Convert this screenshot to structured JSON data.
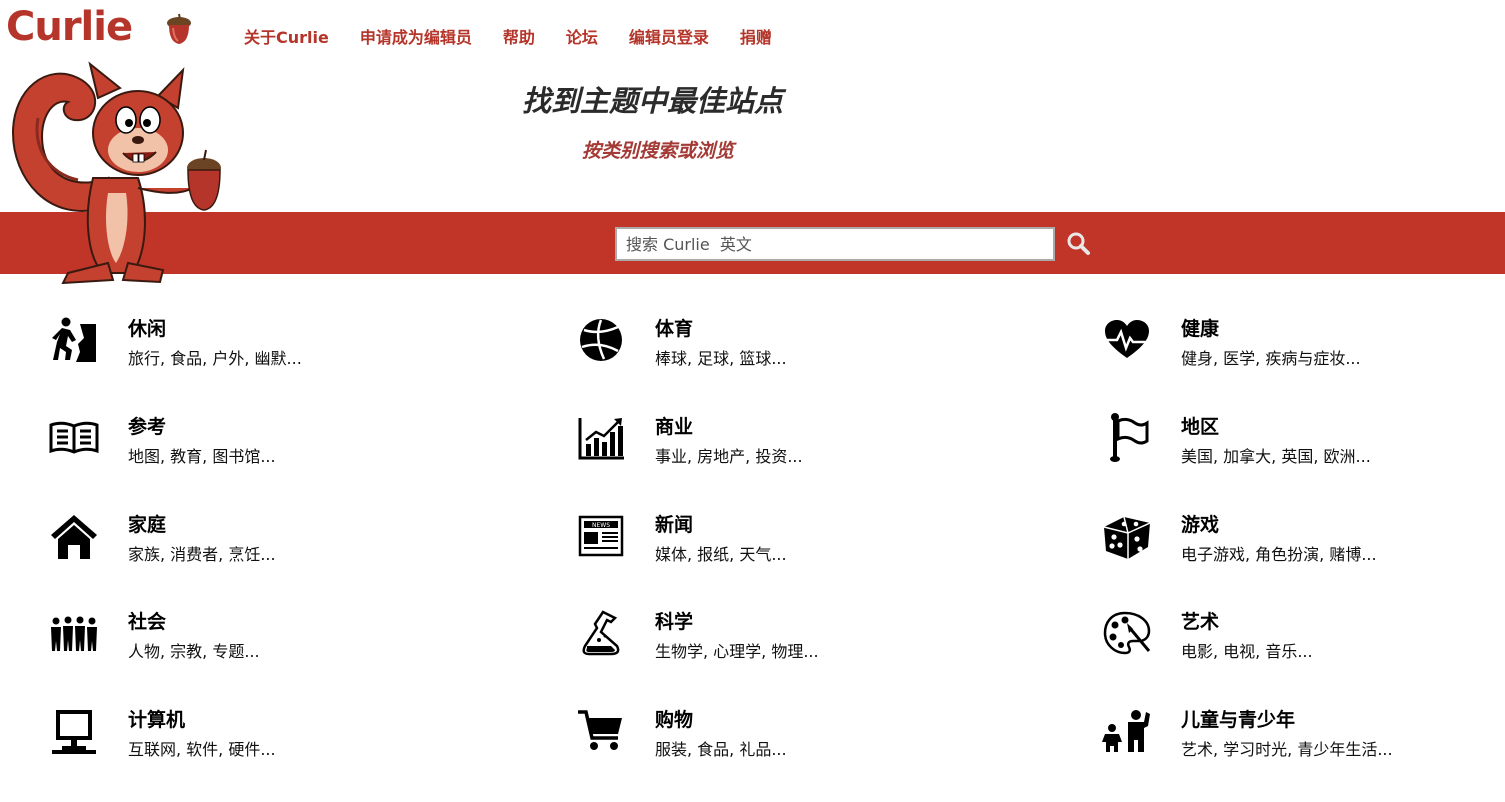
{
  "logo": {
    "text": "Curlie"
  },
  "nav": [
    {
      "label": "关于Curlie"
    },
    {
      "label": "申请成为编辑员"
    },
    {
      "label": "帮助"
    },
    {
      "label": "论坛"
    },
    {
      "label": "编辑员登录"
    },
    {
      "label": "捐赠"
    }
  ],
  "hero": {
    "title": "找到主题中最佳站点",
    "subtitle": "按类别搜索或浏览"
  },
  "search": {
    "placeholder": "搜索 Curlie  英文"
  },
  "colors": {
    "brand": "#c03528",
    "link": "#b5352a"
  },
  "categories": [
    {
      "name": "休闲",
      "subs": "旅行, 食品, 户外, 幽默...",
      "icon": "climber-icon"
    },
    {
      "name": "体育",
      "subs": "棒球, 足球, 篮球...",
      "icon": "volleyball-icon"
    },
    {
      "name": "健康",
      "subs": "健身, 医学, 疾病与症妆...",
      "icon": "heartbeat-icon"
    },
    {
      "name": "参考",
      "subs": "地图, 教育, 图书馆...",
      "icon": "open-book-icon"
    },
    {
      "name": "商业",
      "subs": "事业, 房地产, 投资...",
      "icon": "bar-chart-icon"
    },
    {
      "name": "地区",
      "subs": "美国, 加拿大, 英国, 欧洲...",
      "icon": "flag-icon"
    },
    {
      "name": "家庭",
      "subs": "家族, 消费者, 烹饪...",
      "icon": "house-icon"
    },
    {
      "name": "新闻",
      "subs": "媒体, 报纸, 天气...",
      "icon": "newspaper-icon"
    },
    {
      "name": "游戏",
      "subs": "电子游戏, 角色扮演, 赌博...",
      "icon": "dice-icon"
    },
    {
      "name": "社会",
      "subs": "人物, 宗教, 专题...",
      "icon": "people-group-icon"
    },
    {
      "name": "科学",
      "subs": "生物学, 心理学, 物理...",
      "icon": "flask-icon"
    },
    {
      "name": "艺术",
      "subs": "电影, 电视, 音乐...",
      "icon": "palette-icon"
    },
    {
      "name": "计算机",
      "subs": "互联网, 软件, 硬件...",
      "icon": "computer-icon"
    },
    {
      "name": "购物",
      "subs": "服装, 食品, 礼品...",
      "icon": "shopping-cart-icon"
    },
    {
      "name": "儿童与青少年",
      "subs": "艺术, 学习时光, 青少年生活...",
      "icon": "parent-child-icon"
    }
  ]
}
